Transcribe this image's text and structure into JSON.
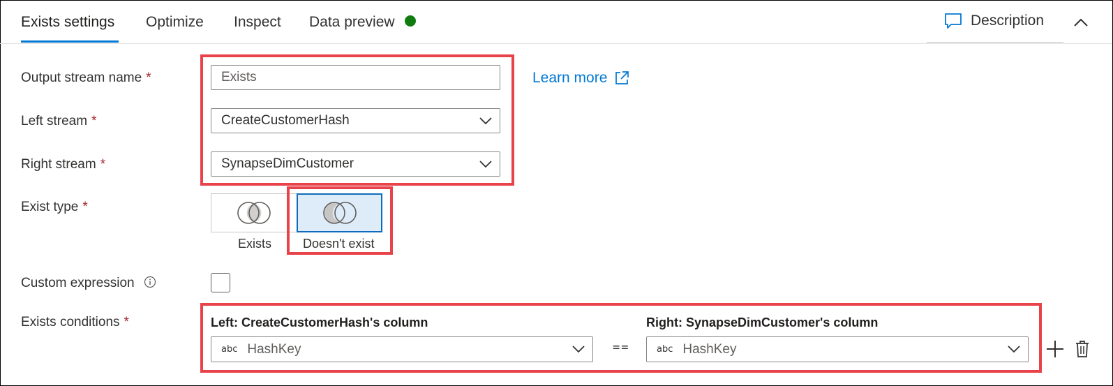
{
  "tabs": [
    {
      "label": "Exists settings",
      "active": true
    },
    {
      "label": "Optimize",
      "active": false
    },
    {
      "label": "Inspect",
      "active": false
    },
    {
      "label": "Data preview",
      "active": false,
      "status_color": "#107c10"
    }
  ],
  "header": {
    "description_label": "Description"
  },
  "form": {
    "output_stream": {
      "label": "Output stream name",
      "required_mark": "*",
      "value": "Exists"
    },
    "learn_more": "Learn more",
    "left_stream": {
      "label": "Left stream",
      "required_mark": "*",
      "value": "CreateCustomerHash"
    },
    "right_stream": {
      "label": "Right stream",
      "required_mark": "*",
      "value": "SynapseDimCustomer"
    },
    "exist_type": {
      "label": "Exist type",
      "required_mark": "*",
      "options": [
        "Exists",
        "Doesn't exist"
      ],
      "selected": "Doesn't exist"
    },
    "custom_expression": {
      "label": "Custom expression",
      "checked": false
    },
    "exists_conditions": {
      "label": "Exists conditions",
      "required_mark": "*",
      "left_header": "Left: CreateCustomerHash's column",
      "right_header": "Right: SynapseDimCustomer's column",
      "type_badge": "abc",
      "left_value": "HashKey",
      "operator": "==",
      "right_value": "HashKey"
    }
  },
  "colors": {
    "accent": "#0078d4",
    "highlight": "#e8434a",
    "required": "#a4262c"
  }
}
